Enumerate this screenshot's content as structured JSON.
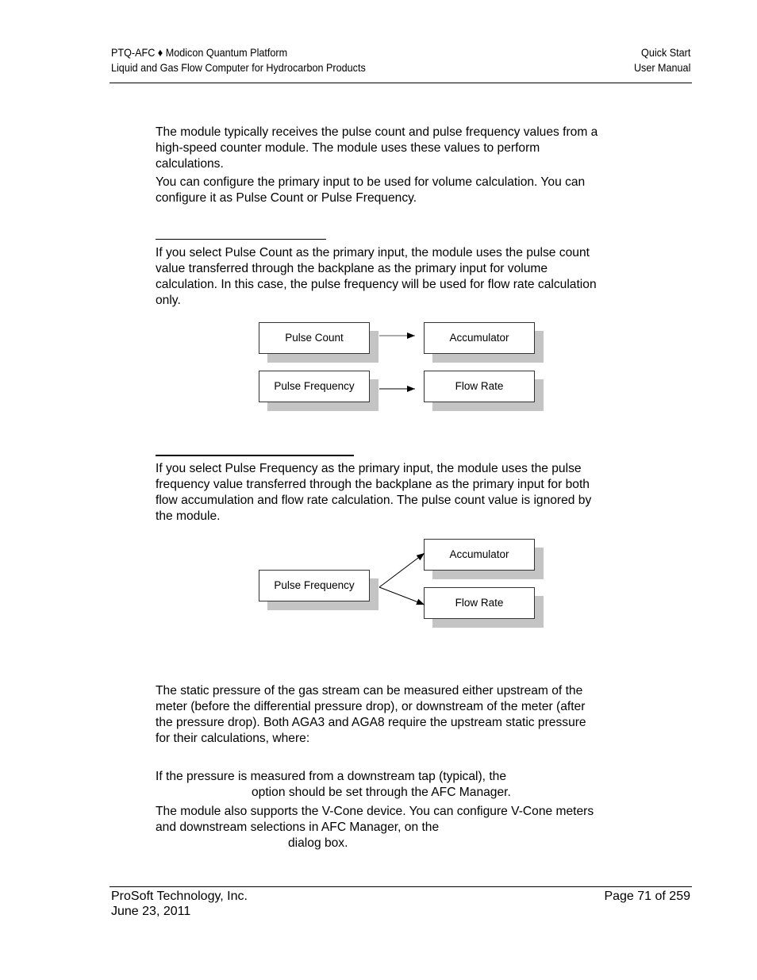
{
  "header": {
    "left_line1": "PTQ-AFC ♦ Modicon Quantum Platform",
    "left_line2": "Liquid and Gas Flow Computer for Hydrocarbon Products",
    "right_line1": "Quick Start",
    "right_line2": "User Manual"
  },
  "intro": {
    "p1": [
      "The module typically receives the pulse count and pulse frequency values from a",
      "high-speed counter module. The module uses these values to perform",
      "calculations."
    ],
    "p2": [
      "You can configure the primary input to be used for volume calculation. You can",
      "configure it as Pulse Count or Pulse Frequency."
    ]
  },
  "pulse_count_section": {
    "text": [
      "If you select Pulse Count as the primary input, the module uses the pulse count",
      "value transferred through the backplane as the primary input for volume",
      "calculation. In this case, the pulse frequency will be used for flow rate calculation",
      "only."
    ],
    "diagram": {
      "boxes": [
        "Pulse Count",
        "Accumulator",
        "Pulse Frequency",
        "Flow Rate"
      ]
    }
  },
  "pulse_frequency_section": {
    "text": [
      "If you select Pulse Frequency as the primary input, the module uses the pulse",
      "frequency value transferred through the backplane as the primary input for both",
      "flow accumulation and flow rate calculation. The pulse count value is ignored by",
      "the module."
    ],
    "diagram": {
      "boxes": [
        "Pulse Frequency",
        "Accumulator",
        "Flow Rate"
      ]
    }
  },
  "pressure_section": {
    "p1": [
      "The static pressure of the gas stream can be measured either upstream of the",
      "meter (before the differential pressure drop), or downstream of the meter (after",
      "the pressure drop). Both AGA3 and AGA8 require the upstream static pressure",
      "for their calculations, where:"
    ],
    "p2": [
      "If the pressure is measured from a downstream tap (typical), the",
      "option should be set through the AFC Manager."
    ],
    "p3": [
      "The module also supports the V-Cone device. You can configure V-Cone meters",
      "and downstream selections in AFC Manager, on the",
      "dialog box."
    ]
  },
  "footer": {
    "company": "ProSoft Technology, Inc.",
    "date": "June 23, 2011",
    "page": "Page 71 of 259"
  }
}
